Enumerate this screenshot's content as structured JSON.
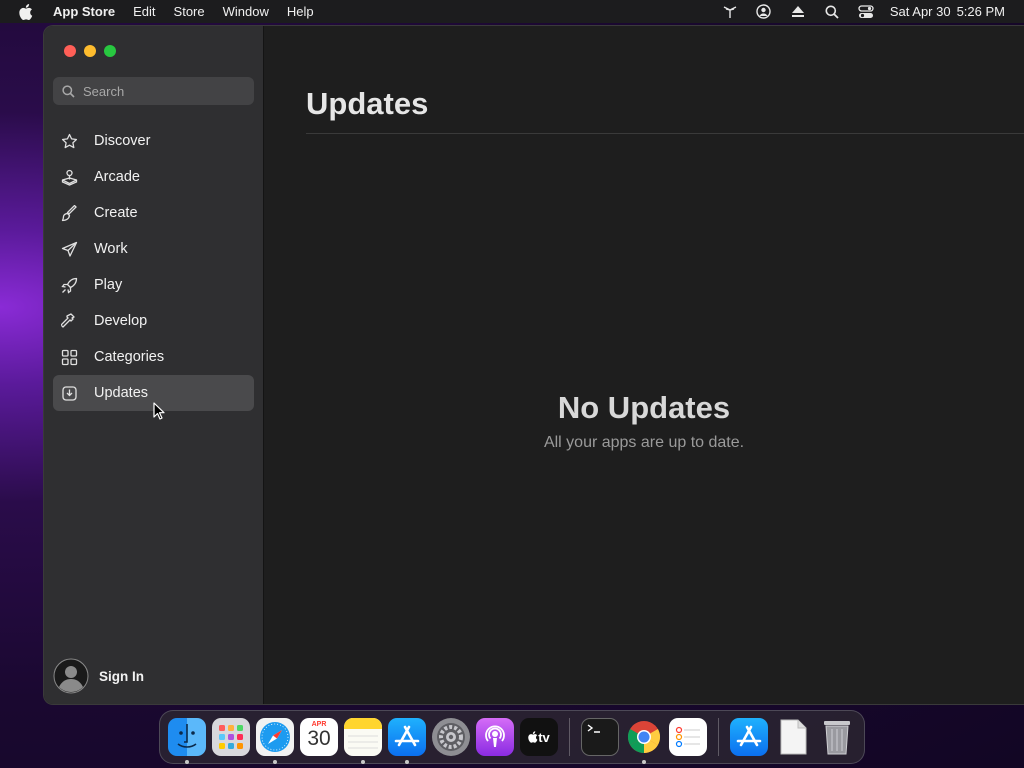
{
  "menubar": {
    "app_name": "App Store",
    "menus": [
      "Edit",
      "Store",
      "Window",
      "Help"
    ],
    "status_icons": [
      "wifi-antenna-icon",
      "user-account-icon",
      "eject-icon",
      "search-icon",
      "control-center-icon"
    ],
    "date": "Sat Apr 30",
    "time": "5:26 PM"
  },
  "sidebar": {
    "search_placeholder": "Search",
    "items": [
      {
        "label": "Discover",
        "icon": "star-icon"
      },
      {
        "label": "Arcade",
        "icon": "joystick-icon"
      },
      {
        "label": "Create",
        "icon": "brush-icon"
      },
      {
        "label": "Work",
        "icon": "paper-plane-icon"
      },
      {
        "label": "Play",
        "icon": "rocket-icon"
      },
      {
        "label": "Develop",
        "icon": "hammer-icon"
      },
      {
        "label": "Categories",
        "icon": "grid-icon"
      },
      {
        "label": "Updates",
        "icon": "download-tray-icon",
        "selected": true
      }
    ],
    "sign_in": "Sign In"
  },
  "main": {
    "title": "Updates",
    "empty_title": "No Updates",
    "empty_subtitle": "All your apps are up to date."
  },
  "dock": {
    "calendar_month": "APR",
    "calendar_day": "30",
    "tv_label": "tv",
    "apps": [
      "finder",
      "launchpad",
      "safari",
      "calendar",
      "notes",
      "app-store",
      "system-preferences",
      "podcasts",
      "apple-tv",
      "terminal",
      "chrome",
      "reminders",
      "app-store-folder",
      "document",
      "trash"
    ]
  },
  "colors": {
    "window_bg": "#1e1e1e",
    "sidebar_bg": "#2f2f31",
    "selected_bg": "#4a4a4c",
    "close": "#ff5f57",
    "minimize": "#febc2e",
    "maximize": "#28c840"
  }
}
